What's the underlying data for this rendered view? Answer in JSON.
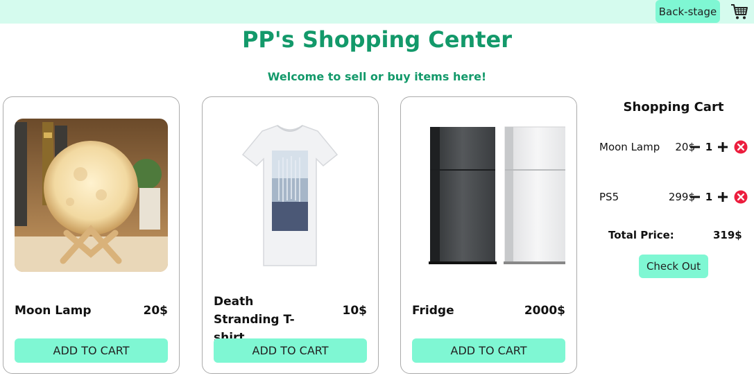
{
  "header": {
    "backstage_label": "Back-stage",
    "cart_icon": "shopping-cart-icon",
    "bg_color": "#d5fbee",
    "accent_color": "#7ff7d3"
  },
  "title": "PP's Shopping Center",
  "subtitle": "Welcome to sell or buy items here!",
  "title_color": "#13996a",
  "products": [
    {
      "name": "Moon Lamp",
      "price": "20$",
      "button": "ADD TO CART",
      "image": "moon-lamp-image"
    },
    {
      "name": "Death Stranding T-shirt",
      "price": "10$",
      "button": "ADD TO CART",
      "image": "tshirt-image"
    },
    {
      "name": "Fridge",
      "price": "2000$",
      "button": "ADD TO CART",
      "image": "fridge-image"
    }
  ],
  "cart": {
    "title": "Shopping Cart",
    "items": [
      {
        "name": "Moon Lamp",
        "price": "20$",
        "qty": "1"
      },
      {
        "name": "PS5",
        "price": "299$",
        "qty": "1"
      }
    ],
    "total_label": "Total Price:",
    "total_value": "319$",
    "checkout_label": "Check Out"
  }
}
